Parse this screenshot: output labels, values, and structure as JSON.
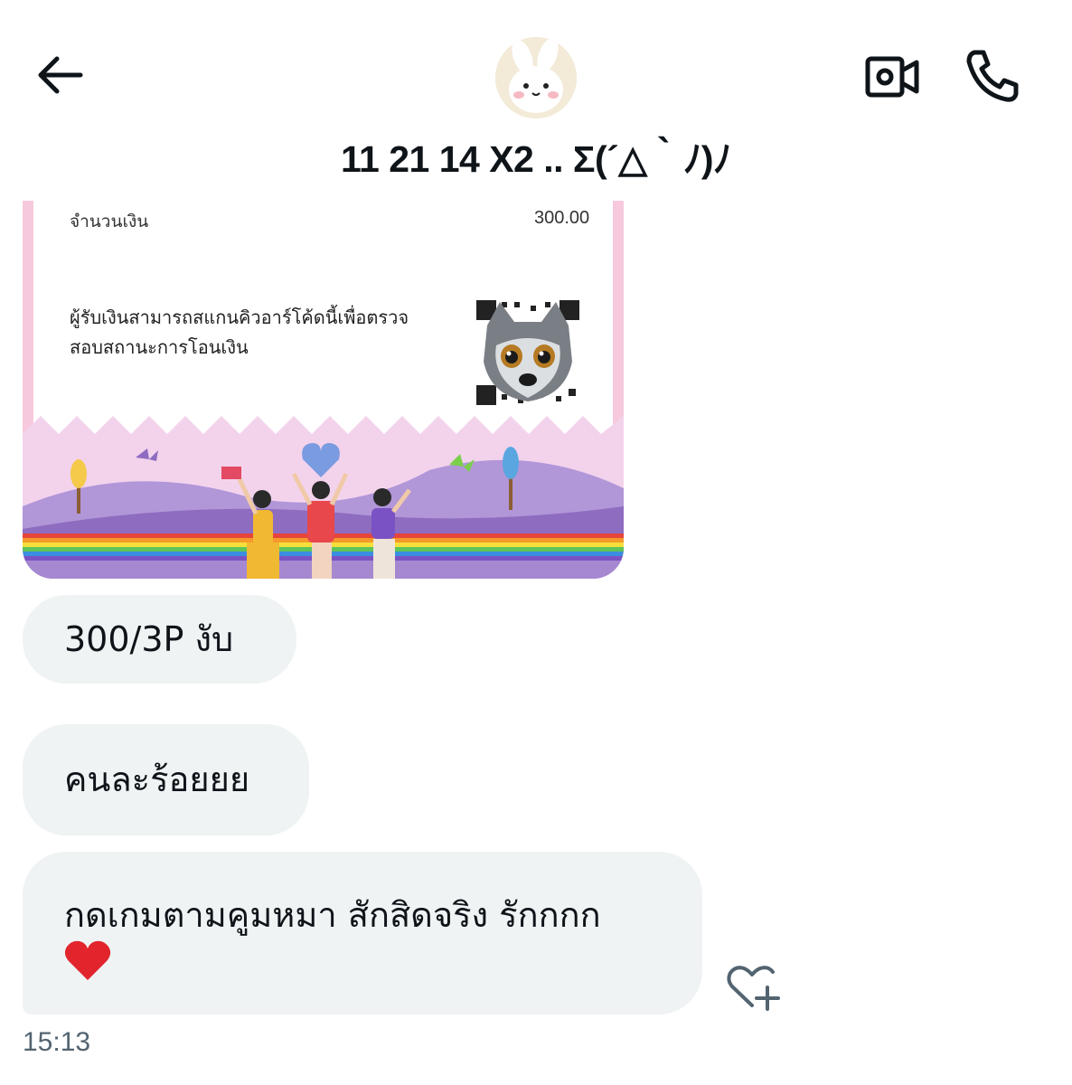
{
  "header": {
    "title": "11 21 14 X2 .. Σ(´△｀ﾉ)ﾉ",
    "back_icon": "arrow-left-icon",
    "video_icon": "video-camera-icon",
    "call_icon": "phone-icon"
  },
  "receipt": {
    "amount_label": "จำนวนเงิน",
    "amount_value": "300.00",
    "scan_note": "ผู้รับเงินสามารถสแกนคิวอาร์โค้ดนี้เพื่อตรวจสอบสถานะการโอนเงิน"
  },
  "messages": [
    {
      "text": "300/3P งับ"
    },
    {
      "text": "คนละร้อยยย"
    },
    {
      "text": "กดเกมตามคูมหมา สักสิดจริง รักกกก",
      "emoji": "heart-emoji"
    }
  ],
  "timestamp": "15:13",
  "colors": {
    "bubble_bg": "#eff3f4",
    "text": "#0f1419",
    "muted": "#536471",
    "receipt_pink": "#fbe3ee",
    "hill_purple": "#8e6cc0"
  }
}
